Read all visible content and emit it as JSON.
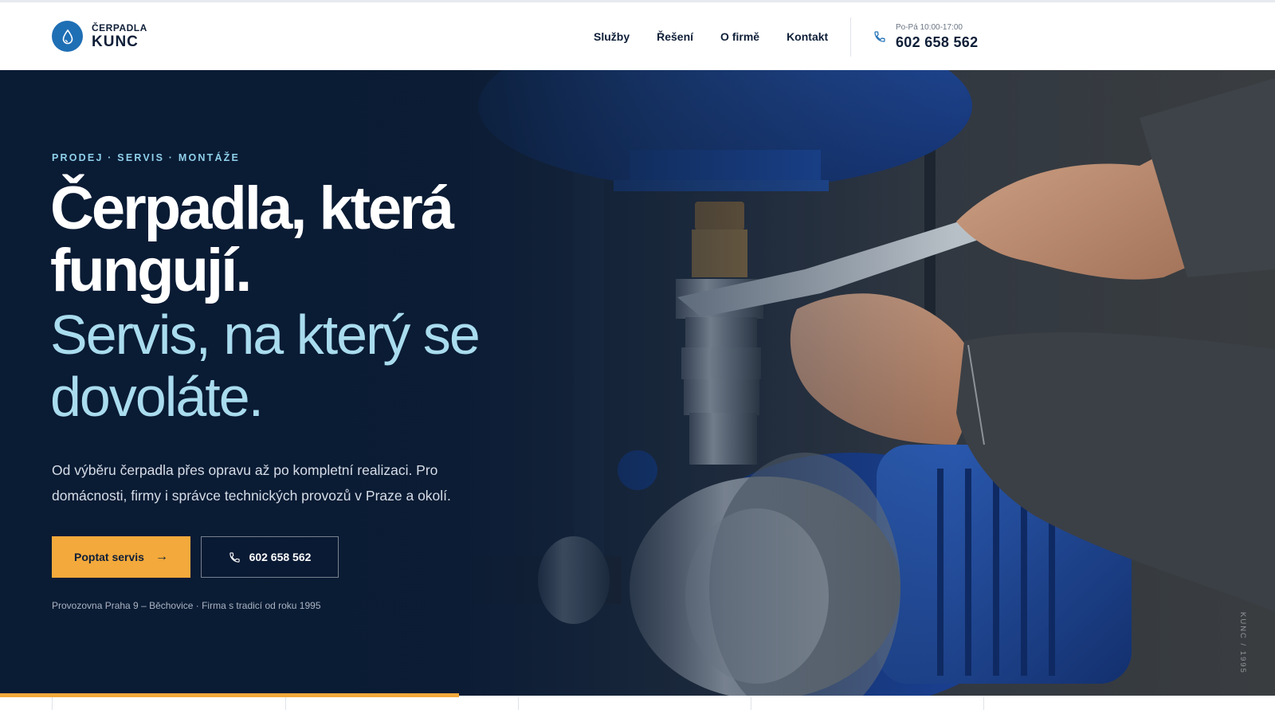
{
  "brand": {
    "small": "ČERPADLA",
    "big": "KUNC"
  },
  "nav": {
    "items": [
      "Služby",
      "Řešení",
      "O firmě",
      "Kontakt"
    ],
    "phone_hours": "Po-Pá 10:00-17:00",
    "phone": "602 658 562"
  },
  "hero": {
    "eyebrow": "PRODEJ · SERVIS · MONTÁŽE",
    "title_bold": "Čerpadla, která fungují.",
    "title_light": "Servis, na který se dovoláte.",
    "lead": "Od výběru čerpadla přes opravu až po kompletní realizaci. Pro domácnosti, firmy i správce technických provozů v Praze a okolí.",
    "cta_primary": "Poptat servis",
    "cta_phone": "602 658 562",
    "footnote": "Provozovna Praha 9 – Běchovice · Firma s tradicí od roku 1995",
    "vertical_mark": "KUNC / 1995"
  },
  "slider": {
    "progress": 0.36
  },
  "colors": {
    "accent": "#f3a93b",
    "brand_blue": "#1f6fb5",
    "navy": "#0a1b34",
    "light_blue": "#a9dcee"
  }
}
